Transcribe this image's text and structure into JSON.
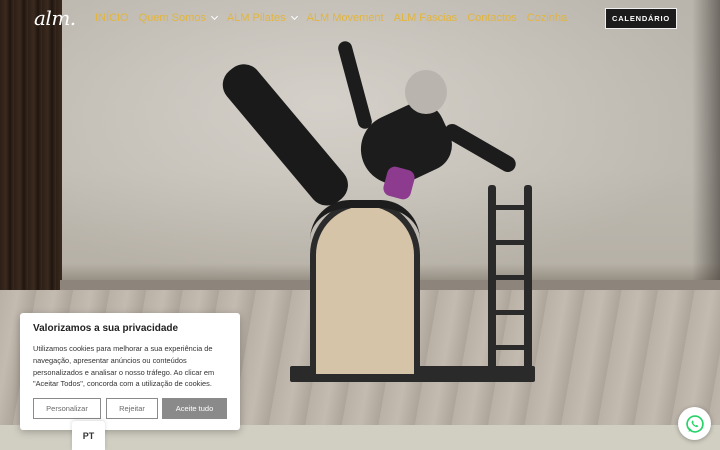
{
  "brand": {
    "logo_text": "alm."
  },
  "nav": {
    "items": [
      {
        "label": "INÍCIO",
        "has_dropdown": false
      },
      {
        "label": "Quem Somos",
        "has_dropdown": true
      },
      {
        "label": "ALM Pilates",
        "has_dropdown": true
      },
      {
        "label": "ALM Movement",
        "has_dropdown": false
      },
      {
        "label": "ALM Fascias",
        "has_dropdown": false
      },
      {
        "label": "Contactos",
        "has_dropdown": false
      },
      {
        "label": "Cozinha",
        "has_dropdown": false
      }
    ],
    "cta_label": "CALENDÁRIO"
  },
  "cookie_banner": {
    "title": "Valorizamos a sua privacidade",
    "text": "Utilizamos cookies para melhorar a sua experiência de navegação, apresentar anúncios ou conteúdos personalizados e analisar o nosso tráfego. Ao clicar em \"Aceitar Todos\", concorda com a utilização de cookies.",
    "personalize_label": "Personalizar",
    "reject_label": "Rejeitar",
    "accept_label": "Aceite tudo"
  },
  "language": {
    "current": "PT"
  },
  "colors": {
    "nav_text": "#e3b53c",
    "cta_bg": "#1c1c1c",
    "accept_bg": "#8a8a8a",
    "bottom_band": "#d1cfc2",
    "whatsapp_green": "#25d366"
  },
  "icons": {
    "whatsapp": "whatsapp-icon",
    "dropdown": "chevron-down-icon"
  }
}
